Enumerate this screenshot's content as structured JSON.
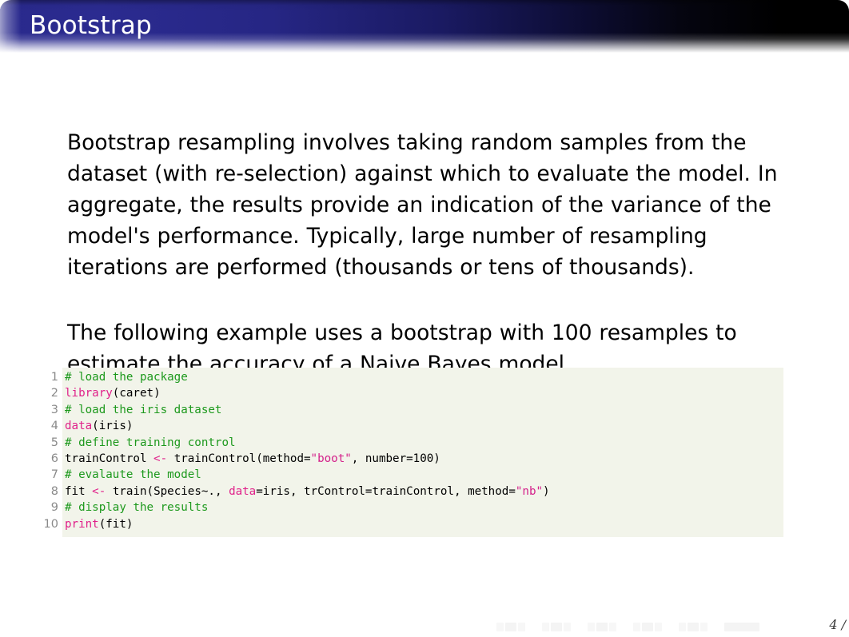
{
  "slide": {
    "title": "Bootstrap",
    "accent_color": "#2b2b90",
    "titlebar_end_color": "#000000"
  },
  "body": {
    "paragraph_1": "Bootstrap resampling involves taking random samples from the dataset (with re-selection) against which to evaluate the model. In aggregate, the results provide an indication of the variance of the model's performance. Typically, large number of resampling iterations are performed (thousands or tens of thousands).",
    "paragraph_2": "The following example uses a bootstrap with 100 resamples to estimate the accuracy of a Naive Bayes model."
  },
  "code": {
    "language": "R",
    "background_color": "#f2f4ea",
    "comment_color": "#1d991d",
    "keyword_color": "#e0218a",
    "string_color": "#d4208a",
    "linenumber_color": "#8a8a8a",
    "lines": [
      {
        "n": "1",
        "text": "# load the package"
      },
      {
        "n": "2",
        "text": "library(caret)"
      },
      {
        "n": "3",
        "text": "# load the iris dataset"
      },
      {
        "n": "4",
        "text": "data(iris)"
      },
      {
        "n": "5",
        "text": "# define training control"
      },
      {
        "n": "6",
        "text": "trainControl <- trainControl(method=\"boot\", number=100)"
      },
      {
        "n": "7",
        "text": "# evalaute the model"
      },
      {
        "n": "8",
        "text": "fit <- train(Species~., data=iris, trControl=trainControl, method=\"nb\")"
      },
      {
        "n": "9",
        "text": "# display the results"
      },
      {
        "n": "10",
        "text": "print(fit)"
      }
    ]
  },
  "footer": {
    "page_number": "4 /",
    "nav_symbols": [
      "slide-back-icon",
      "slide-forward-icon",
      "frame-back-icon",
      "frame-forward-icon",
      "subsection-back-icon",
      "subsection-forward-icon",
      "section-back-icon",
      "section-forward-icon",
      "presentation-back-icon",
      "presentation-forward-icon",
      "appendix-icon",
      "find-icon"
    ]
  }
}
